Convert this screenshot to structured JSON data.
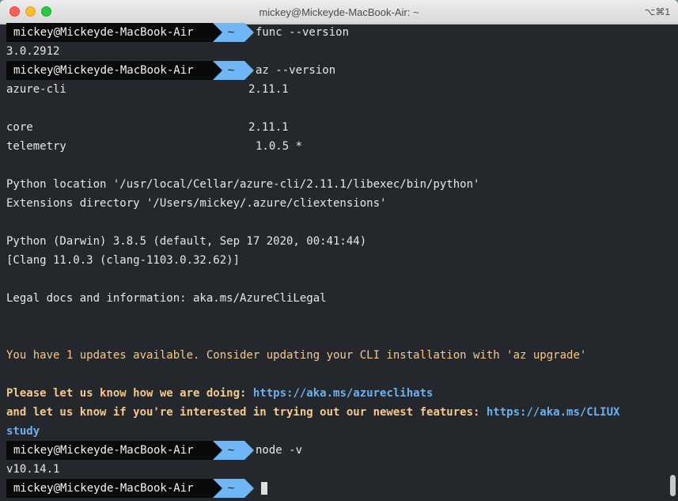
{
  "window": {
    "title": "mickey@Mickeyde-MacBook-Air: ~",
    "shortcut": "⌥⌘1"
  },
  "prompt": {
    "user": "mickey@Mickeyde-MacBook-Air",
    "dir": "~"
  },
  "commands": {
    "c1": "func --version",
    "c2": "az --version",
    "c3": "node -v"
  },
  "output": {
    "func_version": "3.0.2912",
    "azure_cli_label": "azure-cli",
    "azure_cli_version": "2.11.1",
    "core_label": "core",
    "core_version": "2.11.1",
    "telemetry_label": "telemetry",
    "telemetry_version": "1.0.5 *",
    "python_location": "Python location '/usr/local/Cellar/azure-cli/2.11.1/libexec/bin/python'",
    "extensions_dir": "Extensions directory '/Users/mickey/.azure/cliextensions'",
    "python_version": "Python (Darwin) 3.8.5 (default, Sep 17 2020, 00:41:44)",
    "clang": "[Clang 11.0.3 (clang-1103.0.32.62)]",
    "legal": "Legal docs and information: aka.ms/AzureCliLegal",
    "updates": "You have 1 updates available. Consider updating your CLI installation with 'az upgrade'",
    "feedback_text": "Please let us know how we are doing: ",
    "feedback_link": "https://aka.ms/azureclihats",
    "features_text": "and let us know if you're interested in trying out our newest features: ",
    "features_link": "https://aka.ms/CLIUX",
    "features_link_wrap": "study",
    "node_version": "v10.14.1"
  }
}
